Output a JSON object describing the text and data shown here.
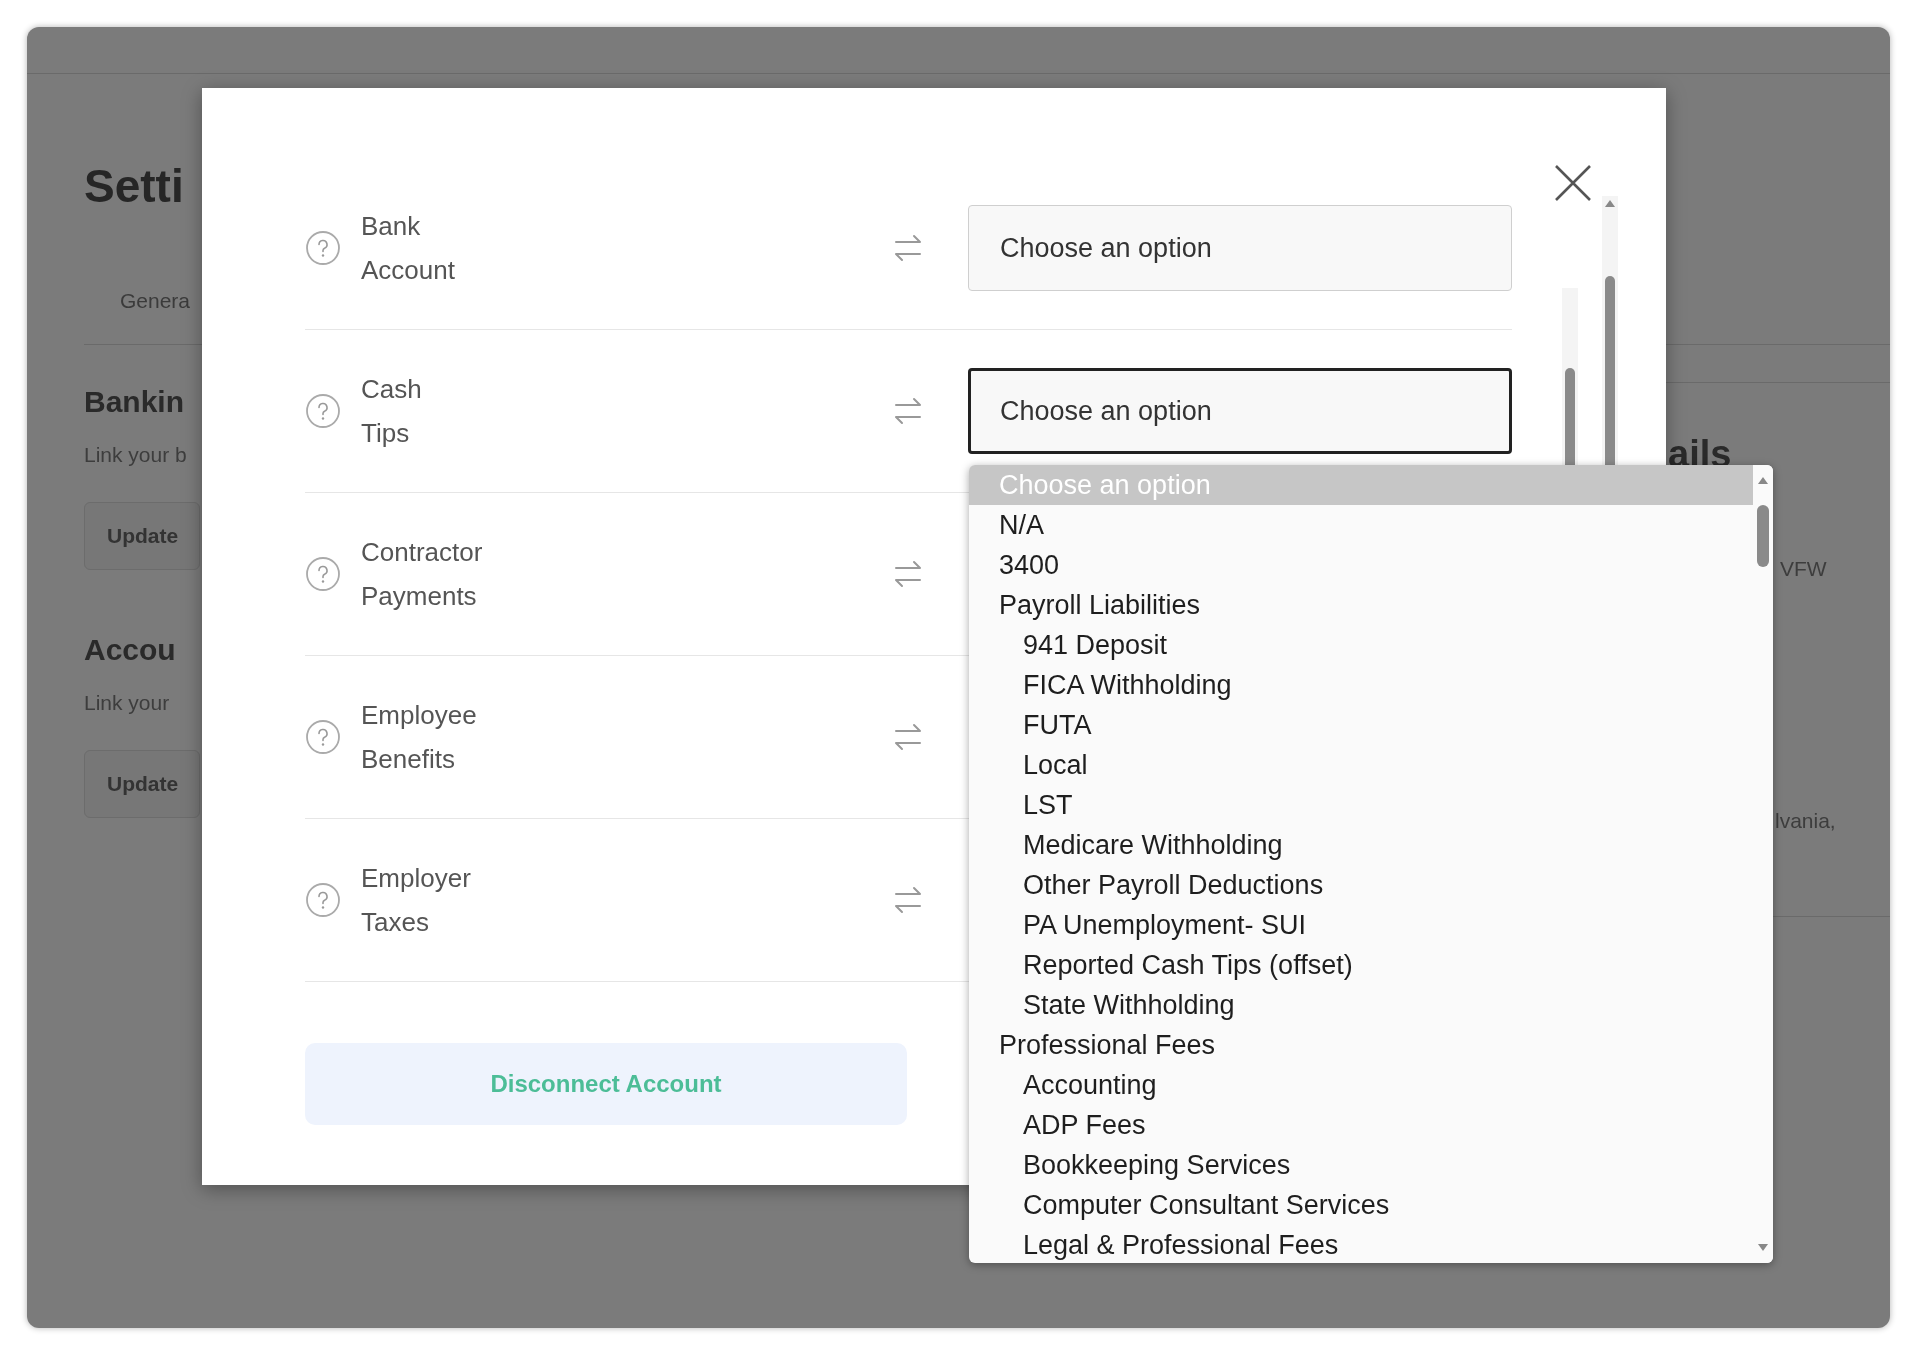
{
  "background": {
    "title": "Setti",
    "tab": "Genera",
    "sections": [
      {
        "heading": "Bankin",
        "text": "Link your b",
        "button": "Update"
      },
      {
        "heading": "Accou",
        "text": "Link your",
        "button": "Update"
      }
    ],
    "right_heading": "ails",
    "right_texts": [
      "VFW",
      "lvania,"
    ]
  },
  "modal": {
    "rows": [
      {
        "label": "Bank Account",
        "value": "Choose an option",
        "focused": false
      },
      {
        "label": "Cash Tips",
        "value": "Choose an option",
        "focused": true
      },
      {
        "label": "Contractor Payments"
      },
      {
        "label": "Employee Benefits"
      },
      {
        "label": "Employer Taxes"
      }
    ],
    "disconnect_button": "Disconnect Account"
  },
  "dropdown": {
    "options": [
      {
        "label": "Choose an option",
        "selected": true
      },
      {
        "label": "N/A",
        "selected": false
      },
      {
        "label": "3400",
        "selected": false
      },
      {
        "label": "Payroll Liabilities",
        "selected": false,
        "children": [
          {
            "label": "941 Deposit",
            "selected": false
          },
          {
            "label": "FICA Withholding",
            "selected": false
          },
          {
            "label": "FUTA",
            "selected": false
          },
          {
            "label": "Local",
            "selected": false
          },
          {
            "label": "LST",
            "selected": false
          },
          {
            "label": "Medicare Withholding",
            "selected": false
          },
          {
            "label": "Other Payroll Deductions",
            "selected": false
          },
          {
            "label": "PA Unemployment- SUI",
            "selected": false
          },
          {
            "label": "Reported Cash Tips (offset)",
            "selected": false
          },
          {
            "label": "State Withholding",
            "selected": false
          }
        ]
      },
      {
        "label": "Professional Fees",
        "selected": false,
        "children": [
          {
            "label": "Accounting",
            "selected": false
          },
          {
            "label": "ADP Fees",
            "selected": false
          },
          {
            "label": "Bookkeeping Services",
            "selected": false
          },
          {
            "label": "Computer Consultant Services",
            "selected": false
          },
          {
            "label": "Legal & Professional Fees",
            "selected": false
          }
        ]
      }
    ]
  }
}
